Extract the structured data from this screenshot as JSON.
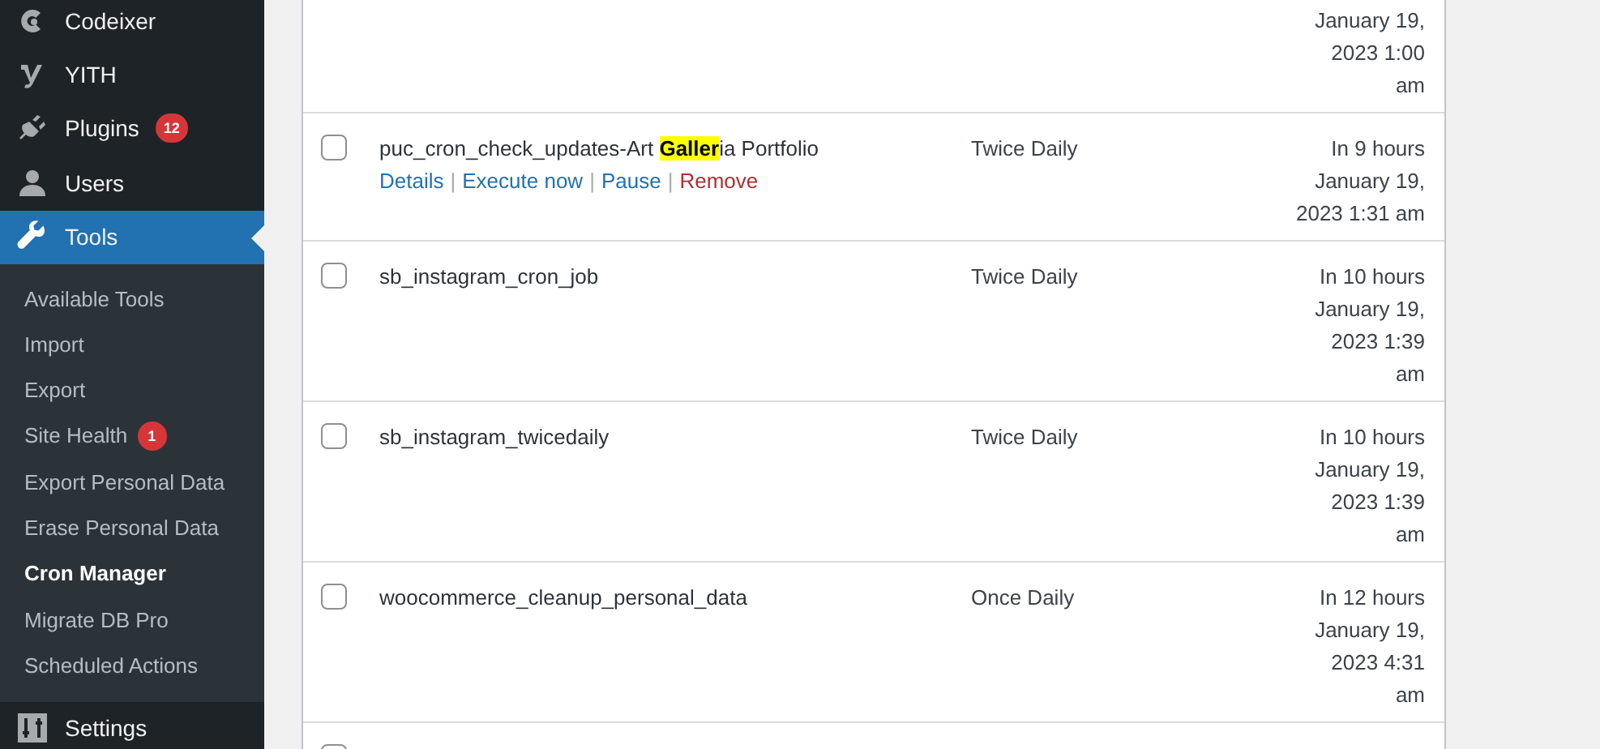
{
  "sidebar": {
    "items": [
      {
        "label": "Codeixer",
        "selected": false
      },
      {
        "label": "YITH",
        "selected": false
      },
      {
        "label": "Plugins",
        "badge": "12",
        "selected": false
      },
      {
        "label": "Users",
        "selected": false
      },
      {
        "label": "Tools",
        "selected": true,
        "children": [
          {
            "label": "Available Tools",
            "selected": false
          },
          {
            "label": "Import",
            "selected": false
          },
          {
            "label": "Export",
            "selected": false
          },
          {
            "label": "Site Health",
            "badge": "1",
            "selected": false
          },
          {
            "label": "Export Personal Data",
            "selected": false
          },
          {
            "label": "Erase Personal Data",
            "selected": false
          },
          {
            "label": "Cron Manager",
            "selected": true
          },
          {
            "label": "Migrate DB Pro",
            "selected": false
          },
          {
            "label": "Scheduled Actions",
            "selected": false
          }
        ]
      },
      {
        "label": "Settings",
        "selected": false
      }
    ]
  },
  "table": {
    "rows": [
      {
        "next_run": [
          "January 19,",
          "2023 1:00",
          "am"
        ]
      },
      {
        "checked": false,
        "name": [
          {
            "text": "puc_cron_check_updates-Art ",
            "highlighted": false
          },
          {
            "text": "Galler",
            "highlighted": true
          },
          {
            "text": "ia Portfolio",
            "highlighted": false
          }
        ],
        "schedule": "Twice Daily",
        "next_run": [
          "In 9 hours",
          "January 19,",
          "2023 1:31 am"
        ],
        "actions": [
          {
            "label": "Details",
            "kind": "link"
          },
          {
            "label": "Execute now",
            "kind": "link"
          },
          {
            "label": "Pause",
            "kind": "link"
          },
          {
            "label": "Remove",
            "kind": "danger"
          }
        ],
        "separator": "|"
      },
      {
        "checked": false,
        "name": [
          {
            "text": "sb_instagram_cron_job",
            "highlighted": false
          }
        ],
        "schedule": "Twice Daily",
        "next_run": [
          "In 10 hours",
          "January 19,",
          "2023 1:39",
          "am"
        ]
      },
      {
        "checked": false,
        "name": [
          {
            "text": "sb_instagram_twicedaily",
            "highlighted": false
          }
        ],
        "schedule": "Twice Daily",
        "next_run": [
          "In 10 hours",
          "January 19,",
          "2023 1:39",
          "am"
        ]
      },
      {
        "checked": false,
        "name": [
          {
            "text": "woocommerce_cleanup_personal_data",
            "highlighted": false
          }
        ],
        "schedule": "Once Daily",
        "next_run": [
          "In 12 hours",
          "January 19,",
          "2023 4:31",
          "am"
        ]
      },
      {
        "checked": false
      }
    ]
  }
}
